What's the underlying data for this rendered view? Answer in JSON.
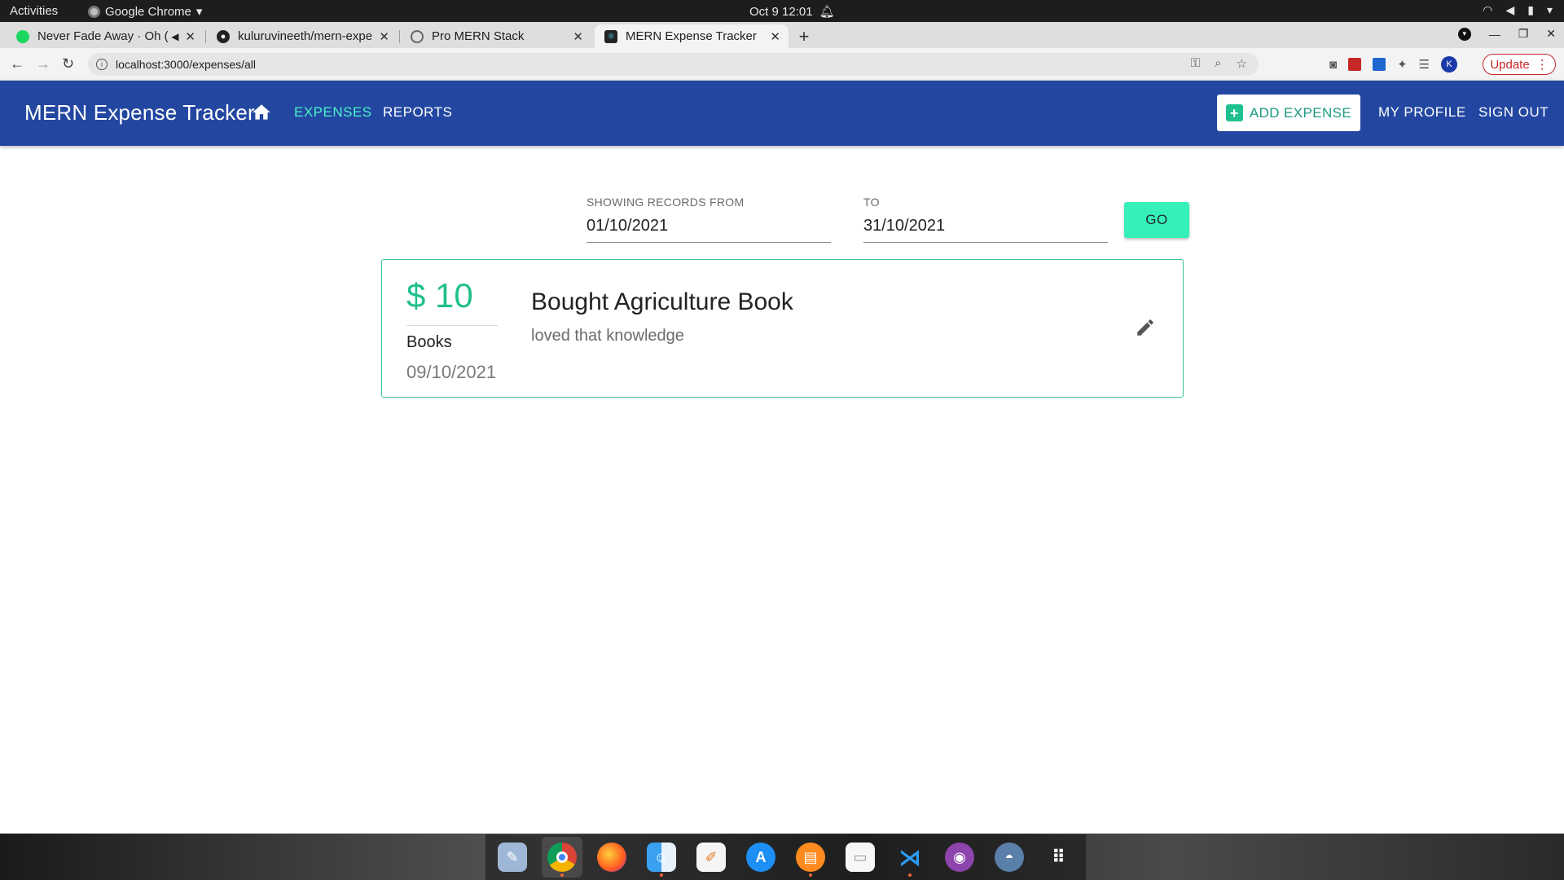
{
  "os": {
    "activities": "Activities",
    "app_name": "Google Chrome",
    "clock": "Oct 9  12:01"
  },
  "browser": {
    "tabs": [
      {
        "label": "Never Fade Away · Oh ("
      },
      {
        "label": "kuluruvineeth/mern-expe"
      },
      {
        "label": "Pro MERN Stack"
      },
      {
        "label": "MERN Expense Tracker"
      }
    ],
    "url": "localhost:3000/expenses/all",
    "update_label": "Update",
    "profile_initial": "K"
  },
  "app": {
    "title": "MERN Expense Tracker",
    "nav": {
      "expenses": "EXPENSES",
      "reports": "REPORTS",
      "add_expense": "ADD EXPENSE",
      "my_profile": "MY PROFILE",
      "sign_out": "SIGN OUT"
    },
    "accent_color": "#4cf2c8",
    "bar_color": "#2347a1"
  },
  "filter": {
    "from_label": "SHOWING RECORDS FROM",
    "from_value": "01/10/2021",
    "to_label": "TO",
    "to_value": "31/10/2021",
    "go_label": "GO"
  },
  "expenses": [
    {
      "amount": "$ 10",
      "category": "Books",
      "incurred_on": "09/10/2021",
      "title": "Bought Agriculture Book",
      "notes": "loved that knowledge"
    }
  ],
  "dock": [
    {
      "icon": "screenshot-icon"
    },
    {
      "icon": "chrome-icon"
    },
    {
      "icon": "firefox-icon"
    },
    {
      "icon": "finder-icon"
    },
    {
      "icon": "text-editor-icon"
    },
    {
      "icon": "app-store-icon"
    },
    {
      "icon": "books-icon"
    },
    {
      "icon": "notes-icon"
    },
    {
      "icon": "vscode-icon"
    },
    {
      "icon": "github-icon"
    },
    {
      "icon": "postgres-icon"
    },
    {
      "icon": "app-grid-icon"
    }
  ]
}
